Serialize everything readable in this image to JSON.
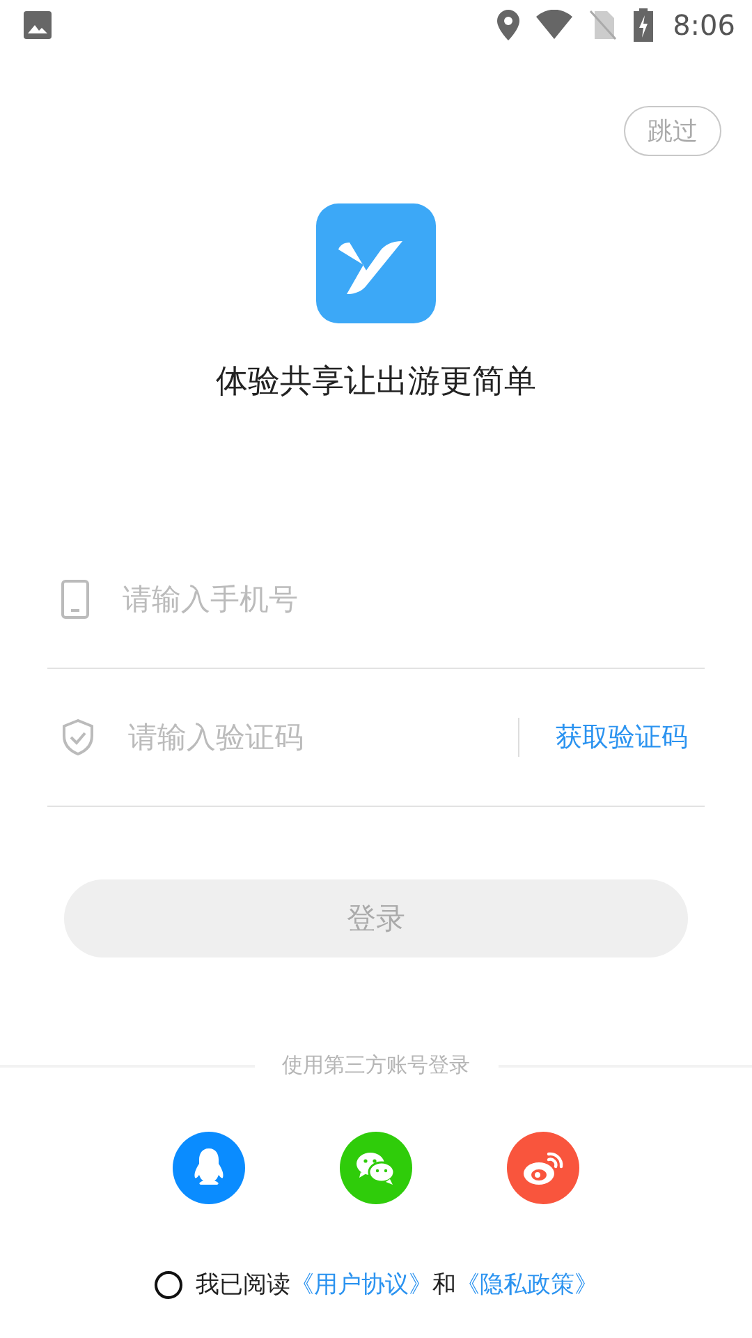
{
  "status_bar": {
    "time": "8:06"
  },
  "skip_button": {
    "label": "跳过"
  },
  "slogan": "体验共享让出游更简单",
  "phone_field": {
    "placeholder": "请输入手机号"
  },
  "code_field": {
    "placeholder": "请输入验证码",
    "get_code_button": "获取验证码"
  },
  "login_button": {
    "label": "登录",
    "disabled": true
  },
  "third_party_label": "使用第三方账号登录",
  "social_logins": [
    {
      "kind": "qq",
      "color": "#0a8cff"
    },
    {
      "kind": "wechat",
      "color": "#2fcc0a"
    },
    {
      "kind": "weibo",
      "color": "#f9553d"
    }
  ],
  "agreement": {
    "checked": false,
    "parts": [
      {
        "kind": "text",
        "text": "我已阅读"
      },
      {
        "kind": "link",
        "text": "《用户协议》"
      },
      {
        "kind": "text",
        "text": "和"
      },
      {
        "kind": "link",
        "text": "《隐私政策》"
      }
    ]
  }
}
